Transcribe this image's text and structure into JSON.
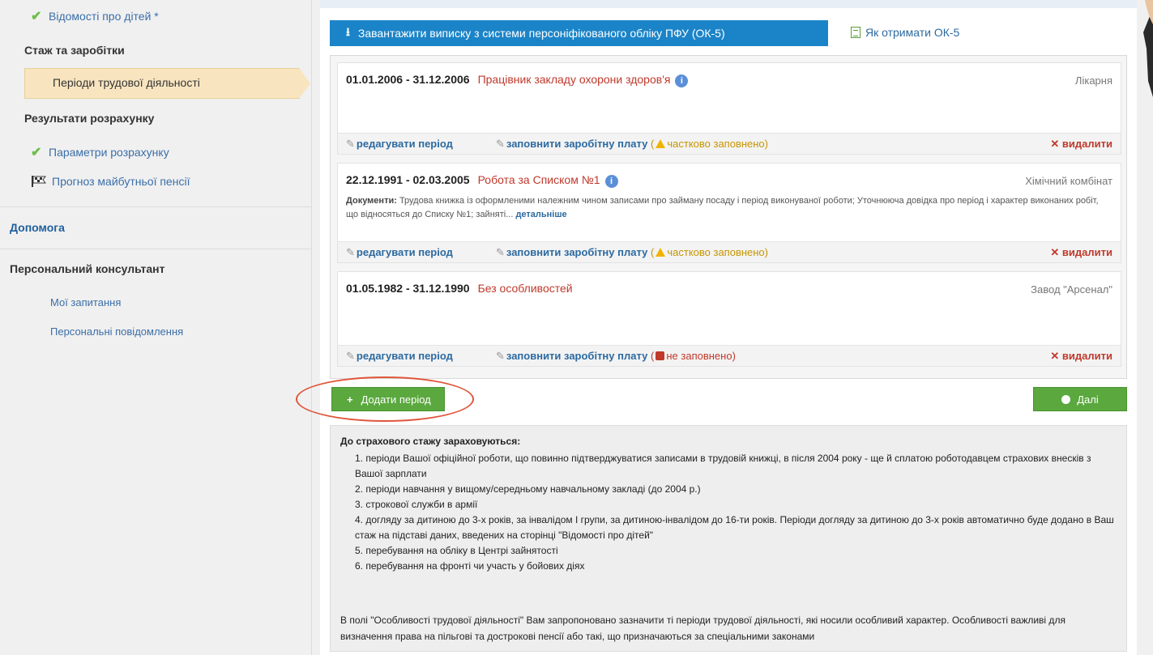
{
  "sidebar": {
    "items": [
      {
        "label": "Відомості про дітей *"
      },
      {
        "label": "Стаж та заробітки"
      },
      {
        "label": "Періоди трудової діяльності"
      },
      {
        "label": "Результати розрахунку"
      },
      {
        "label": "Параметри розрахунку"
      },
      {
        "label": "Прогноз майбутньої пенсії"
      },
      {
        "label": "Допомога"
      },
      {
        "label": "Персональний консультант"
      },
      {
        "label": "Мої запитання"
      },
      {
        "label": "Персональні повідомлення"
      }
    ]
  },
  "toolbar": {
    "upload_label": "Завантажити виписку з системи персоніфікованого обліку ПФУ (ОК-5)",
    "how_label": "Як отримати ОК-5"
  },
  "periods": [
    {
      "dates": "01.01.2006 - 31.12.2006",
      "type": "Працівник закладу охорони здоров'я",
      "place": "Лікарня",
      "docs_label": "",
      "docs_text": "",
      "docs_more": "",
      "edit_label": "редагувати період",
      "fill_label": "заповнити заробітну плату",
      "status_label": "часткововo заповнено",
      "delete_label": "видалити"
    },
    {
      "dates": "22.12.1991 - 02.03.2005",
      "type": "Робота за Списком №1",
      "place": "Хімічний комбінат",
      "docs_label": "Документи:",
      "docs_text": " Трудова книжка із оформленими належним чином записами про займану посаду і період виконуваної роботи; Уточнююча довідка про період і характер виконаних робіт, що відносяться до Списку №1; зайняті...",
      "docs_more": "детальніше",
      "edit_label": "редагувати період",
      "fill_label": "заповнити заробітну плату",
      "status_label": "частково заповнено",
      "delete_label": "видалити"
    },
    {
      "dates": "01.05.1982 - 31.12.1990",
      "type": "Без особливостей",
      "place": "Завод \"Арсенал\"",
      "docs_label": "",
      "docs_text": "",
      "docs_more": "",
      "edit_label": "редагувати період",
      "fill_label": "заповнити заробітну плату",
      "status_label": "не заповнено",
      "delete_label": "видалити"
    }
  ],
  "actions": {
    "add_label": "Додати період",
    "next_label": "Далі"
  },
  "notes": {
    "title": "До страхового стажу зараховуються:",
    "items": [
      "1. періоди Вашої офіційної роботи, що повинно підтверджуватися записами в трудовій книжці, в після 2004 року - ще й сплатою роботодавцем страхових внесків з Вашої зарплати",
      "2. періоди навчання у вищому/середньому навчальному закладі (до 2004 р.)",
      "3. строкової служби в армії",
      "4. догляду за дитиною до 3-х років, за інвалідом І групи, за дитиною-інвалідом до 16-ти років. Періоди догляду за дитиною до 3-х років автоматично буде додано в Ваш стаж на підставі даних, введених на сторінці \"Відомості про дітей\"",
      "5. перебування на обліку в Центрі зайнятості",
      "6. перебування на фронті чи участь у бойових діях"
    ],
    "footer": "В полі \"Особливості трудової діяльності\" Вам запропоновано зазначити ті періоди трудової діяльності, які носили особливий характер. Особливості важливі для визначення права на пільгові та дострокові пенсії або такі, що призначаються за спеціальними законами"
  },
  "colors": {
    "primary_button": "#1b84c8",
    "success_button": "#5aa83e",
    "active_nav": "#f8e5c0",
    "danger": "#c0392b",
    "highlight_ring": "#e0563a"
  }
}
